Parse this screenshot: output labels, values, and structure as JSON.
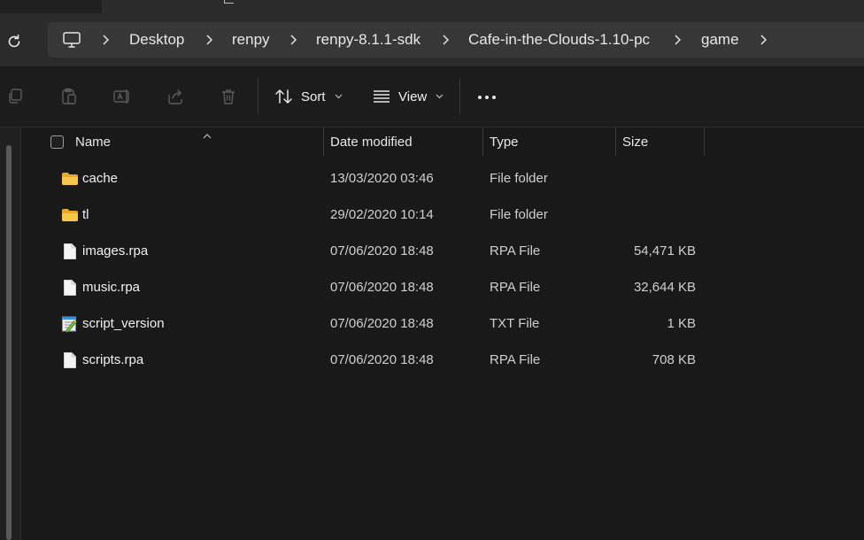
{
  "breadcrumbs": [
    {
      "label": "Desktop"
    },
    {
      "label": "renpy"
    },
    {
      "label": "renpy-8.1.1-sdk"
    },
    {
      "label": "Cafe-in-the-Clouds-1.10-pc"
    },
    {
      "label": "game"
    }
  ],
  "toolbar": {
    "sort_label": "Sort",
    "view_label": "View"
  },
  "columns": {
    "name": "Name",
    "date": "Date modified",
    "type": "Type",
    "size": "Size"
  },
  "files": [
    {
      "name": "cache",
      "date": "13/03/2020 03:46",
      "type": "File folder",
      "size": "",
      "icon": "folder-icon"
    },
    {
      "name": "tl",
      "date": "29/02/2020 10:14",
      "type": "File folder",
      "size": "",
      "icon": "folder-icon"
    },
    {
      "name": "images.rpa",
      "date": "07/06/2020 18:48",
      "type": "RPA File",
      "size": "54,471 KB",
      "icon": "file-icon"
    },
    {
      "name": "music.rpa",
      "date": "07/06/2020 18:48",
      "type": "RPA File",
      "size": "32,644 KB",
      "icon": "file-icon"
    },
    {
      "name": "script_version",
      "date": "07/06/2020 18:48",
      "type": "TXT File",
      "size": "1 KB",
      "icon": "notepad-file-icon"
    },
    {
      "name": "scripts.rpa",
      "date": "07/06/2020 18:48",
      "type": "RPA File",
      "size": "708 KB",
      "icon": "file-icon"
    }
  ],
  "colors": {
    "background": "#191919",
    "address_bar": "#373737",
    "folder": "#f3c34a"
  }
}
